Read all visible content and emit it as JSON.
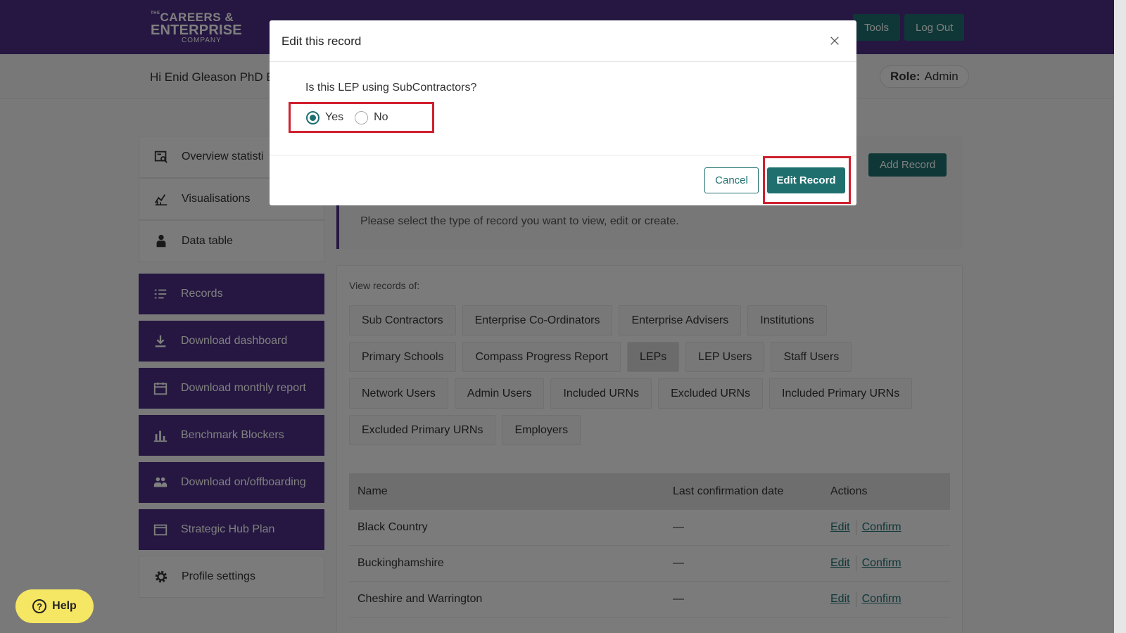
{
  "header": {
    "logo_line1": "CAREERS &",
    "logo_line2": "ENTERPRISE",
    "logo_line3": "COMPANY",
    "logo_prefix": "THE",
    "tools_label": "Tools",
    "logout_label": "Log Out"
  },
  "greeting": "Hi Enid Gleason PhD Ev",
  "role": {
    "label": "Role:",
    "value": "Admin"
  },
  "sidebar": {
    "items": [
      {
        "label": "Overview statisti",
        "icon": "overview-icon",
        "style": "light"
      },
      {
        "label": "Visualisations",
        "icon": "chart-icon",
        "style": "light"
      },
      {
        "label": "Data table",
        "icon": "person-icon",
        "style": "light"
      },
      {
        "label": "Records",
        "icon": "list-icon",
        "style": "dark"
      },
      {
        "label": "Download dashboard",
        "icon": "download-icon",
        "style": "dark"
      },
      {
        "label": "Download monthly report",
        "icon": "calendar-icon",
        "style": "dark"
      },
      {
        "label": "Benchmark Blockers",
        "icon": "bar-chart-icon",
        "style": "dark"
      },
      {
        "label": "Download on/offboarding",
        "icon": "group-icon",
        "style": "dark"
      },
      {
        "label": "Strategic Hub Plan",
        "icon": "folder-icon",
        "style": "dark"
      },
      {
        "label": "Profile settings",
        "icon": "gear-icon",
        "style": "light"
      }
    ]
  },
  "main": {
    "add_record_label": "Add Record",
    "info_text": "Please select the type of record you want to view, edit or create.",
    "view_label": "View records of:",
    "record_types": [
      [
        "Sub Contractors",
        "Enterprise Co-Ordinators",
        "Enterprise Advisers",
        "Institutions"
      ],
      [
        "Primary Schools",
        "Compass Progress Report",
        "LEPs",
        "LEP Users",
        "Staff Users"
      ],
      [
        "Network Users",
        "Admin Users",
        "Included URNs",
        "Excluded URNs",
        "Included Primary URNs"
      ],
      [
        "Excluded Primary URNs",
        "Employers"
      ]
    ],
    "active_type": "LEPs",
    "table": {
      "headers": [
        "Name",
        "Last confirmation date",
        "Actions"
      ],
      "rows": [
        {
          "name": "Black Country",
          "date": "—"
        },
        {
          "name": "Buckinghamshire",
          "date": "—"
        },
        {
          "name": "Cheshire and Warrington",
          "date": "—"
        }
      ],
      "edit_label": "Edit",
      "confirm_label": "Confirm"
    }
  },
  "modal": {
    "title": "Edit this record",
    "question": "Is this LEP using SubContractors?",
    "options": [
      "Yes",
      "No"
    ],
    "selected": "Yes",
    "cancel_label": "Cancel",
    "submit_label": "Edit Record"
  },
  "help_label": "Help"
}
